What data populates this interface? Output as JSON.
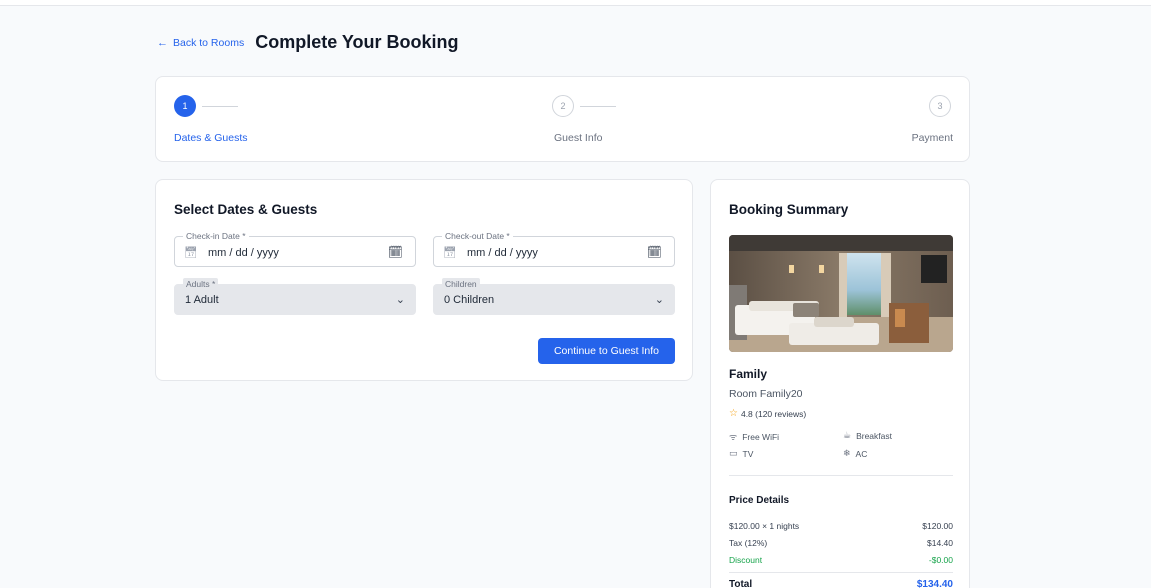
{
  "header": {
    "back_label": "Back to Rooms",
    "title": "Complete Your Booking"
  },
  "stepper": {
    "steps": [
      {
        "number": "1",
        "label": "Dates & Guests",
        "active": true
      },
      {
        "number": "2",
        "label": "Guest Info",
        "active": false
      },
      {
        "number": "3",
        "label": "Payment",
        "active": false
      }
    ]
  },
  "form": {
    "title": "Select Dates & Guests",
    "checkin_label": "Check-in Date *",
    "checkin_value": "mm / dd / yyyy",
    "checkout_label": "Check-out Date *",
    "checkout_value": "mm / dd / yyyy",
    "adults_label": "Adults *",
    "adults_value": "1 Adult",
    "children_label": "Children",
    "children_value": "0 Children",
    "continue_label": "Continue to Guest Info"
  },
  "summary": {
    "title": "Booking Summary",
    "room_type": "Family",
    "room_name": "Room Family20",
    "rating": "4.8 (120 reviews)",
    "amenities": [
      {
        "label": "Free WiFi",
        "icon": "wifi-icon"
      },
      {
        "label": "Breakfast",
        "icon": "coffee-icon"
      },
      {
        "label": "TV",
        "icon": "tv-icon"
      },
      {
        "label": "AC",
        "icon": "snowflake-icon"
      }
    ],
    "price_title": "Price Details",
    "rows": [
      {
        "label": "$120.00 × 1 nights",
        "amount": "$120.00"
      },
      {
        "label": "Tax (12%)",
        "amount": "$14.40"
      },
      {
        "label": "Discount",
        "amount": "-$0.00"
      }
    ],
    "total_label": "Total",
    "total_amount": "$134.40"
  },
  "colors": {
    "accent": "#2563eb",
    "discount": "#16a34a",
    "star": "#f59e0b"
  }
}
